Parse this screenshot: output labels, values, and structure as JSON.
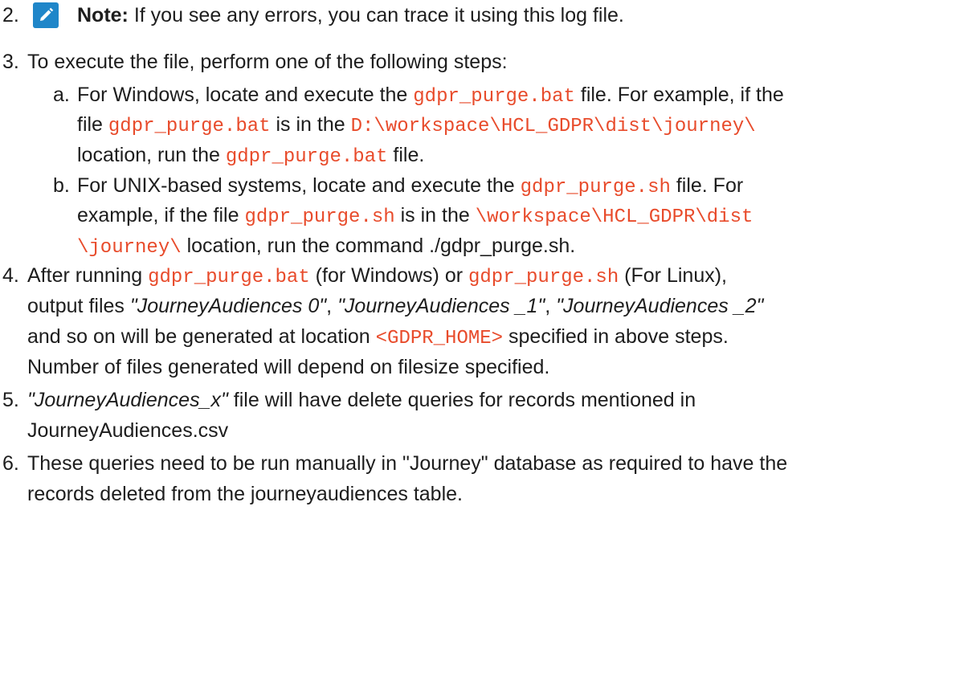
{
  "step2": {
    "number": "2.",
    "note_label": "Note:",
    "note_text": " If you see any errors, you can trace it using this log file."
  },
  "step3": {
    "number": "3.",
    "intro": "To execute the file, perform one of the following steps:",
    "a": {
      "letter": "a.",
      "t1": "For Windows, locate and execute the ",
      "c1": "gdpr_purge.bat",
      "t2": " file. For example, if the",
      "t3": "file ",
      "c2": "gdpr_purge.bat",
      "t4": " is in the ",
      "c3": "D:\\workspace\\HCL_GDPR\\dist\\journey\\",
      "t5": "location, run the ",
      "c4": "gdpr_purge.bat",
      "t6": " file."
    },
    "b": {
      "letter": "b.",
      "t1": "For UNIX-based systems, locate and execute the ",
      "c1": "gdpr_purge.sh",
      "t2": " file. For",
      "t3": "example, if the file ",
      "c2": "gdpr_purge.sh",
      "t4": " is in the ",
      "c3a": "\\workspace\\HCL_GDPR\\dist",
      "c3b": "\\journey\\",
      "t5": " location, run the command ./gdpr_purge.sh."
    }
  },
  "step4": {
    "number": "4.",
    "t1": "After running ",
    "c1": "gdpr_purge.bat",
    "t2": " (for Windows) or ",
    "c2": "gdpr_purge.sh",
    "t3": " (For Linux),",
    "t4": "output files ",
    "e1": "\"JourneyAudiences 0\"",
    "s1": ", ",
    "e2": "\"JourneyAudiences _1\"",
    "s2": ", ",
    "e3": "\"JourneyAudiences _2\"",
    "t5": "and so on will be generated at location ",
    "c3": "<GDPR_HOME>",
    "t6": " specified in above steps.",
    "t7": "Number of files generated will depend on filesize specified."
  },
  "step5": {
    "number": "5.",
    "e1": "\"JourneyAudiences_x\"",
    "t1": " file will have delete queries for records mentioned in",
    "t2": "JourneyAudiences.csv"
  },
  "step6": {
    "number": "6.",
    "t1": "These queries need to be run manually in \"Journey\" database as required to have the",
    "t2": "records deleted from the journeyaudiences table."
  },
  "icons": {
    "note": "pencil-note-icon",
    "note_color": "#1f86c9"
  }
}
